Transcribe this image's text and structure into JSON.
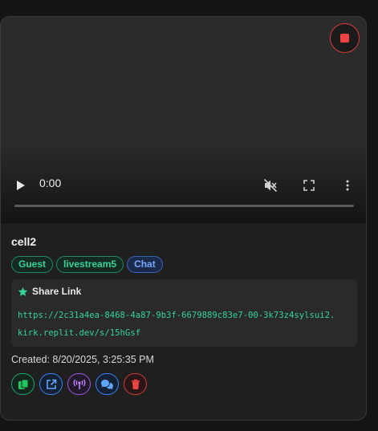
{
  "card": {
    "title": "cell2",
    "tags": [
      "Guest",
      "livestream5",
      "Chat"
    ],
    "share": {
      "label": "Share Link",
      "url_line1": "https://2c31a4ea-8468-4a87-9b3f-6679889c83e7-00-3k73z4sylsui2.",
      "url_line2": "kirk.replit.dev/s/15hGsf"
    },
    "created": "Created: 8/20/2025, 3:25:35 PM"
  },
  "video": {
    "time": "0:00",
    "progress": 0
  },
  "icons": {
    "stop": "stop-icon",
    "play": "play-icon",
    "mute": "muted-speaker-icon",
    "fullscreen": "fullscreen-icon",
    "more": "more-vertical-icon",
    "star": "star-icon",
    "copy": "copy-icon",
    "open": "external-link-icon",
    "broadcast": "broadcast-icon",
    "chat": "chat-icon",
    "delete": "trash-icon"
  },
  "colors": {
    "accent_green": "#34d399",
    "accent_blue": "#3b82f6",
    "accent_purple": "#9b59d6",
    "danger": "#ef4444"
  }
}
